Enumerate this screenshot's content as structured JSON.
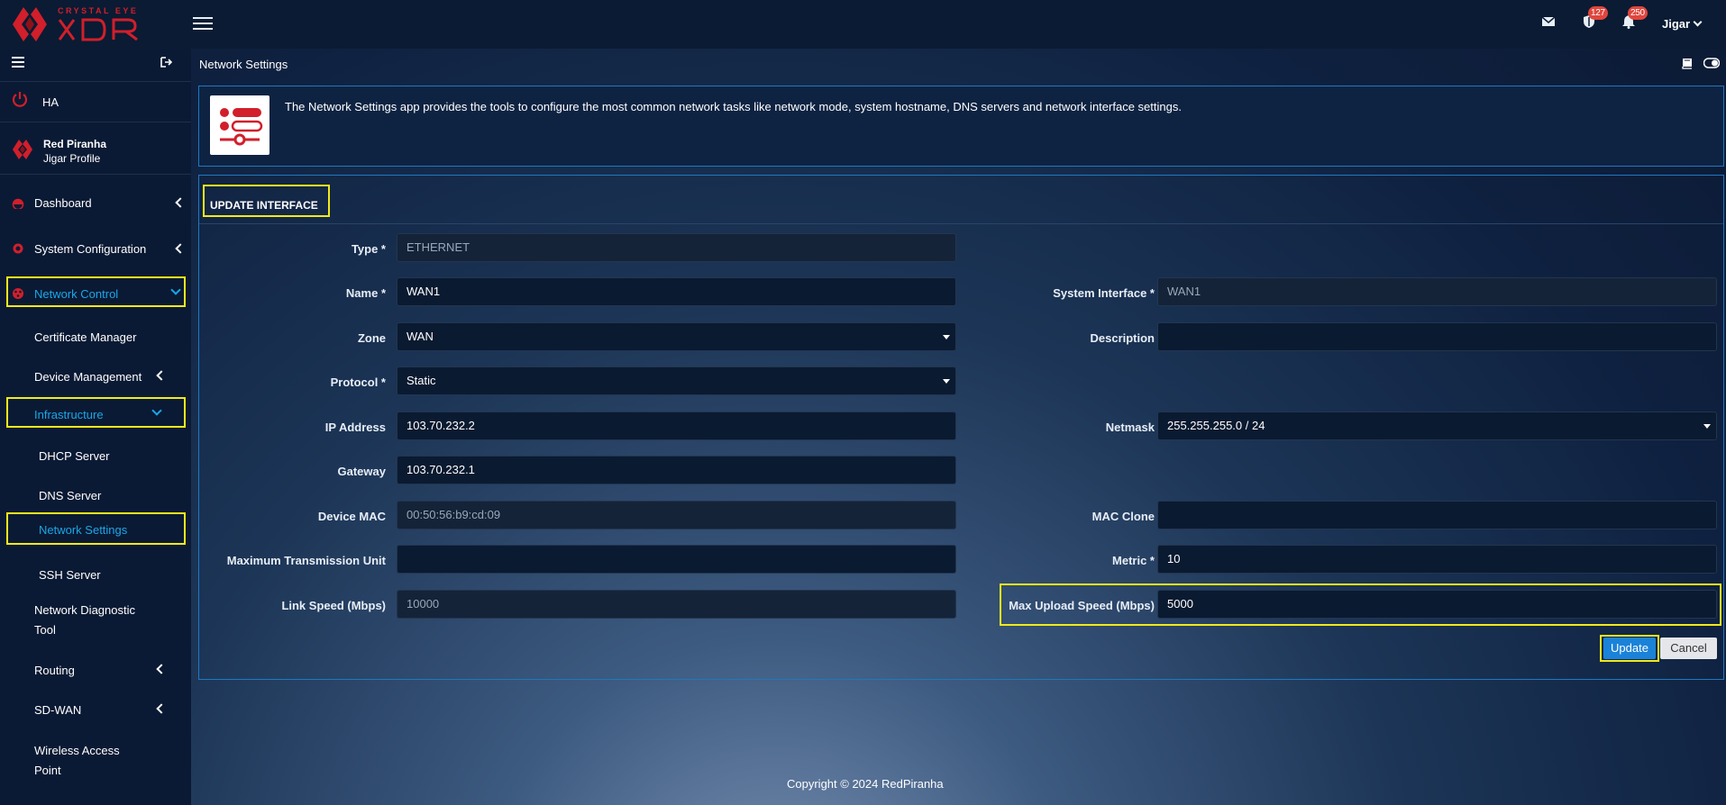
{
  "brand": {
    "logo_text_top": "CRYSTAL EYE",
    "logo_text_main": "XDR",
    "accent": "#d11f2b"
  },
  "header": {
    "mail_icon": "envelope-icon",
    "shield_badge": "127",
    "bell_badge": "250",
    "user_name": "Jigar"
  },
  "sidebar": {
    "ha_label": "HA",
    "profile_company": "Red Piranha",
    "profile_name": "Jigar Profile",
    "items": [
      {
        "label": "Dashboard"
      },
      {
        "label": "System Configuration"
      },
      {
        "label": "Network Control"
      },
      {
        "label": "Certificate Manager"
      },
      {
        "label": "Device Management"
      },
      {
        "label": "Infrastructure"
      },
      {
        "label": "DHCP Server"
      },
      {
        "label": "DNS Server"
      },
      {
        "label": "Network Settings"
      },
      {
        "label": "SSH Server"
      },
      {
        "label": "Network Diagnostic"
      },
      {
        "label": "Tool"
      },
      {
        "label": "Routing"
      },
      {
        "label": "SD-WAN"
      },
      {
        "label": "Wireless Access"
      },
      {
        "label": "Point"
      }
    ]
  },
  "page": {
    "title": "Network Settings",
    "info_text": "The Network Settings app provides the tools to configure the most common network tasks like network mode, system hostname, DNS servers and network interface settings.",
    "form_title": "UPDATE INTERFACE"
  },
  "form": {
    "type": {
      "label": "Type *",
      "value": "ETHERNET"
    },
    "name": {
      "label": "Name *",
      "value": "WAN1"
    },
    "zone": {
      "label": "Zone",
      "value": "WAN"
    },
    "protocol": {
      "label": "Protocol *",
      "value": "Static"
    },
    "ip": {
      "label": "IP Address",
      "value": "103.70.232.2"
    },
    "gateway": {
      "label": "Gateway",
      "value": "103.70.232.1"
    },
    "mac": {
      "label": "Device MAC",
      "value": "00:50:56:b9:cd:09"
    },
    "mtu": {
      "label": "Maximum Transmission Unit",
      "value": ""
    },
    "link_speed": {
      "label": "Link Speed (Mbps)",
      "value": "10000"
    },
    "sys_iface": {
      "label": "System Interface *",
      "value": "WAN1"
    },
    "description": {
      "label": "Description",
      "value": ""
    },
    "netmask": {
      "label": "Netmask",
      "value": "255.255.255.0 / 24"
    },
    "mac_clone": {
      "label": "MAC Clone",
      "value": ""
    },
    "metric": {
      "label": "Metric *",
      "value": "10"
    },
    "max_upload": {
      "label": "Max Upload Speed (Mbps)",
      "value": "5000"
    }
  },
  "buttons": {
    "update": "Update",
    "cancel": "Cancel"
  },
  "footer": "Copyright © 2024 RedPiranha"
}
